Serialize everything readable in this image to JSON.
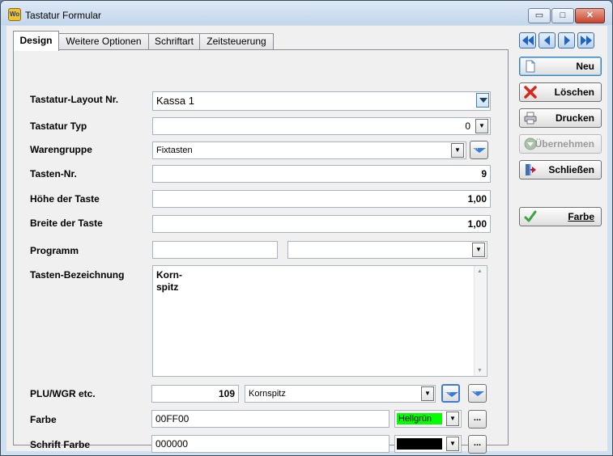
{
  "window": {
    "title": "Tastatur Formular",
    "app_icon_text": "Wo",
    "minimize_glyph": "▭",
    "maximize_glyph": "□",
    "close_glyph": "✕"
  },
  "tabs": [
    "Design",
    "Weitere Optionen",
    "Schriftart",
    "Zeitsteuerung"
  ],
  "form": {
    "layout_label": "Tastatur-Layout Nr.",
    "layout_value": "Kassa 1",
    "typ_label": "Tastatur Typ",
    "typ_value": "0",
    "warengruppe_label": "Warengruppe",
    "warengruppe_value": "Fixtasten",
    "tasten_nr_label": "Tasten-Nr.",
    "tasten_nr_value": "9",
    "hoehe_label": "Höhe der Taste",
    "hoehe_value": "1,00",
    "breite_label": "Breite der Taste",
    "breite_value": "1,00",
    "programm_label": "Programm",
    "programm_value": "",
    "programm_select": "",
    "bezeichnung_label": "Tasten-Bezeichnung",
    "bezeichnung_line1": "Korn-",
    "bezeichnung_line2": "spitz",
    "plu_label": "PLU/WGR etc.",
    "plu_value": "109",
    "plu_name": "Kornspitz",
    "farbe_label": "Farbe",
    "farbe_value": "00FF00",
    "farbe_name": "Hellgrün",
    "farbe_color": "#00ff00",
    "schrift_label": "Schrift Farbe",
    "schrift_value": "000000",
    "schrift_color": "#000000",
    "dots": "..."
  },
  "actions": {
    "neu": "Neu",
    "loeschen": "Löschen",
    "drucken": "Drucken",
    "uebernehmen": "Übernehmen",
    "schliessen": "Schließen",
    "farbe": "Farbe"
  }
}
